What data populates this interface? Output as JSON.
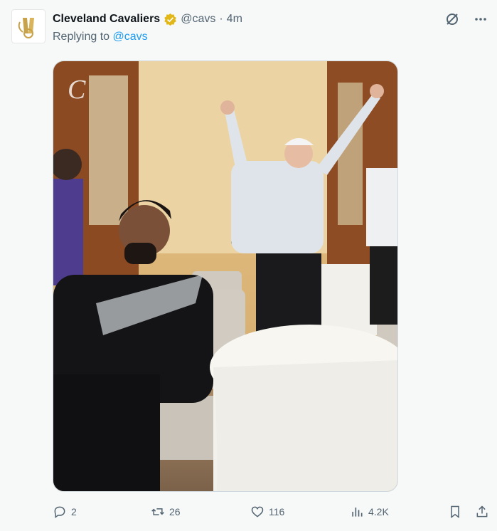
{
  "tweet": {
    "author_name": "Cleveland Cavaliers",
    "handle": "@cavs",
    "separator": "·",
    "time": "4m",
    "reply_prefix": "Replying to",
    "reply_to": "@cavs",
    "media_alt": "Photo: players and staff celebrating in a banquet room",
    "media_watermark": "C"
  },
  "actions": {
    "replies": "2",
    "retweets": "26",
    "likes": "116",
    "views": "4.2K"
  },
  "colors": {
    "accent": "#1d9bf0",
    "muted": "#536471",
    "verified": "#e2b719"
  },
  "icons": {
    "grok": "grok-icon",
    "more": "more-icon",
    "reply": "reply-icon",
    "retweet": "retweet-icon",
    "like": "heart-icon",
    "views": "views-icon",
    "bookmark": "bookmark-icon",
    "share": "share-icon"
  }
}
